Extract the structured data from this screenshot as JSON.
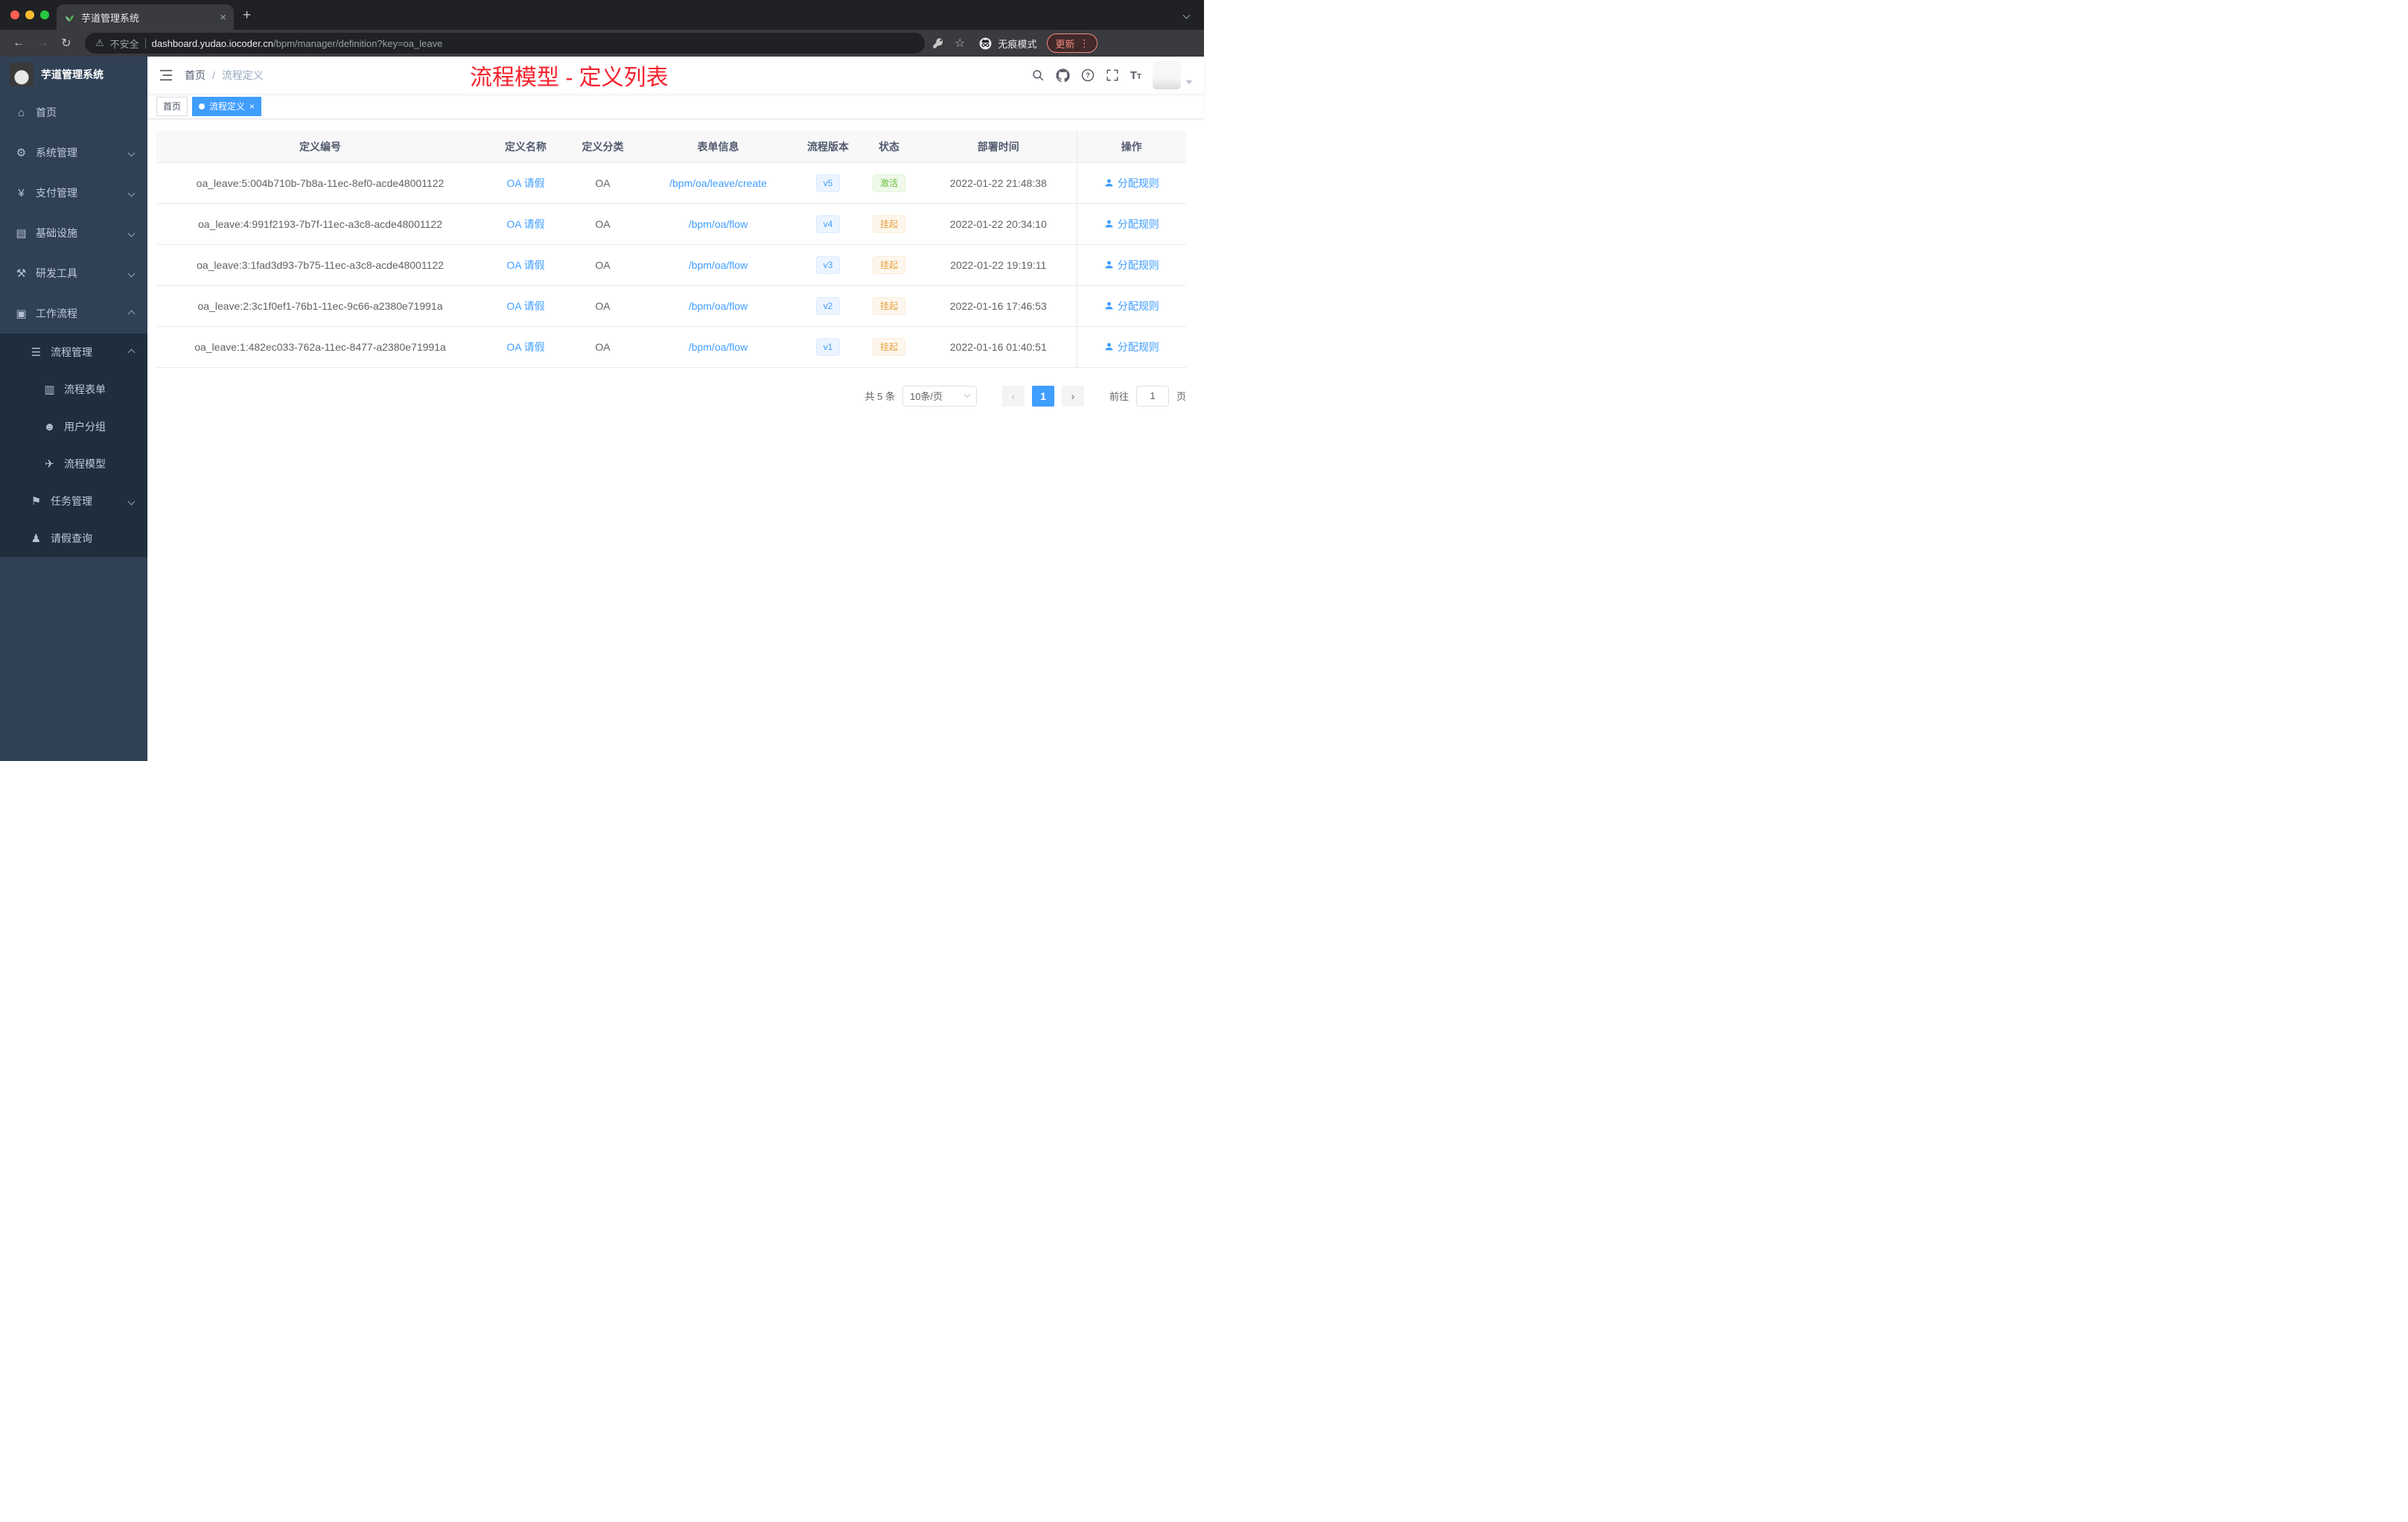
{
  "browser": {
    "tab_title": "芋道管理系统",
    "security_label": "不安全",
    "url_domain": "dashboard.yudao.iocoder.cn",
    "url_path": "/bpm/manager/definition?key=oa_leave",
    "incognito_label": "无痕模式",
    "update_label": "更新"
  },
  "sidebar": {
    "logo_title": "芋道管理系统",
    "items": [
      {
        "label": "首页",
        "icon": "home-icon",
        "glyph": "⌂",
        "level": 1,
        "arrow": "",
        "dark": false
      },
      {
        "label": "系统管理",
        "icon": "gear-icon",
        "glyph": "⚙",
        "level": 1,
        "arrow": "down",
        "dark": false
      },
      {
        "label": "支付管理",
        "icon": "yen-icon",
        "glyph": "¥",
        "level": 1,
        "arrow": "down",
        "dark": false
      },
      {
        "label": "基础设施",
        "icon": "infrastructure-icon",
        "glyph": "▤",
        "level": 1,
        "arrow": "down",
        "dark": false
      },
      {
        "label": "研发工具",
        "icon": "devtools-icon",
        "glyph": "⚒",
        "level": 1,
        "arrow": "down",
        "dark": false
      },
      {
        "label": "工作流程",
        "icon": "workflow-icon",
        "glyph": "▣",
        "level": 1,
        "arrow": "up",
        "dark": false
      },
      {
        "label": "流程管理",
        "icon": "process-list-icon",
        "glyph": "☰",
        "level": 2,
        "arrow": "up",
        "dark": true
      },
      {
        "label": "流程表单",
        "icon": "form-icon",
        "glyph": "▥",
        "level": 3,
        "arrow": "",
        "dark": true
      },
      {
        "label": "用户分组",
        "icon": "user-group-icon",
        "glyph": "☻",
        "level": 3,
        "arrow": "",
        "dark": true
      },
      {
        "label": "流程模型",
        "icon": "paper-plane-icon",
        "glyph": "✈",
        "level": 3,
        "arrow": "",
        "dark": true
      },
      {
        "label": "任务管理",
        "icon": "task-icon",
        "glyph": "⚑",
        "level": 2,
        "arrow": "down",
        "dark": true
      },
      {
        "label": "请假查询",
        "icon": "person-icon",
        "glyph": "♟",
        "level": 2,
        "arrow": "",
        "dark": true
      }
    ]
  },
  "header": {
    "breadcrumb_home": "首页",
    "breadcrumb_sep": "/",
    "breadcrumb_current": "流程定义",
    "annotation": "流程模型 - 定义列表"
  },
  "tags": {
    "home": "首页",
    "current": "流程定义"
  },
  "table": {
    "columns": [
      "定义编号",
      "定义名称",
      "定义分类",
      "表单信息",
      "流程版本",
      "状态",
      "部署时间",
      "操作"
    ],
    "rows": [
      {
        "id": "oa_leave:5:004b710b-7b8a-11ec-8ef0-acde48001122",
        "name": "OA 请假",
        "category": "OA",
        "form": "/bpm/oa/leave/create",
        "version": "v5",
        "status": "激活",
        "status_type": "active",
        "deploy_time": "2022-01-22 21:48:38",
        "action": "分配规则"
      },
      {
        "id": "oa_leave:4:991f2193-7b7f-11ec-a3c8-acde48001122",
        "name": "OA 请假",
        "category": "OA",
        "form": "/bpm/oa/flow",
        "version": "v4",
        "status": "挂起",
        "status_type": "suspended",
        "deploy_time": "2022-01-22 20:34:10",
        "action": "分配规则"
      },
      {
        "id": "oa_leave:3:1fad3d93-7b75-11ec-a3c8-acde48001122",
        "name": "OA 请假",
        "category": "OA",
        "form": "/bpm/oa/flow",
        "version": "v3",
        "status": "挂起",
        "status_type": "suspended",
        "deploy_time": "2022-01-22 19:19:11",
        "action": "分配规则"
      },
      {
        "id": "oa_leave:2:3c1f0ef1-76b1-11ec-9c66-a2380e71991a",
        "name": "OA 请假",
        "category": "OA",
        "form": "/bpm/oa/flow",
        "version": "v2",
        "status": "挂起",
        "status_type": "suspended",
        "deploy_time": "2022-01-16 17:46:53",
        "action": "分配规则"
      },
      {
        "id": "oa_leave:1:482ec033-762a-11ec-8477-a2380e71991a",
        "name": "OA 请假",
        "category": "OA",
        "form": "/bpm/oa/flow",
        "version": "v1",
        "status": "挂起",
        "status_type": "suspended",
        "deploy_time": "2022-01-16 01:40:51",
        "action": "分配规则"
      }
    ]
  },
  "pagination": {
    "total": "共 5 条",
    "page_size": "10条/页",
    "prev": "‹",
    "current_page": "1",
    "next": "›",
    "goto_label": "前往",
    "goto_value": "1",
    "goto_suffix": "页"
  },
  "colors": {
    "accent_blue": "#409eff",
    "success_green": "#67c23a",
    "warning_orange": "#e6a23c",
    "sidebar_bg": "#304156",
    "sidebar_sub_bg": "#1f2d3d",
    "annotation_red": "#f5222d"
  }
}
